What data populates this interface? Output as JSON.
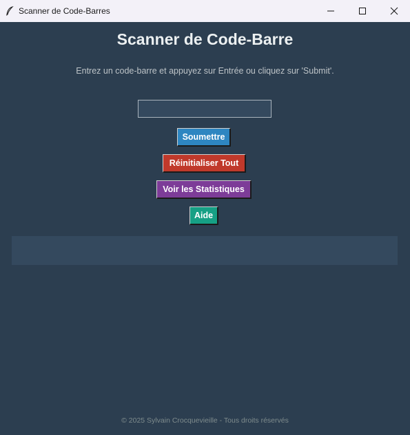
{
  "window": {
    "title": "Scanner de Code-Barres",
    "app_icon": "feather-icon",
    "controls": {
      "minimize_icon": "minimize-icon",
      "maximize_icon": "maximize-icon",
      "close_icon": "close-icon"
    }
  },
  "main": {
    "heading": "Scanner de Code-Barre",
    "instructions": "Entrez un code-barre et appuyez sur Entrée ou cliquez sur 'Submit'.",
    "barcode_input": {
      "value": "",
      "placeholder": ""
    },
    "buttons": {
      "submit": "Soumettre",
      "reset": "Réinitialiser Tout",
      "stats": "Voir les Statistiques",
      "help": "Aide"
    },
    "result_text": ""
  },
  "footer": {
    "text": "© 2025 Sylvain Crocquevieille - Tous droits réservés"
  },
  "colors": {
    "background": "#2c3e50",
    "panel": "#34495e",
    "submit": "#2e86c1",
    "reset": "#c0392b",
    "stats": "#7d3c98",
    "help": "#16a085"
  }
}
